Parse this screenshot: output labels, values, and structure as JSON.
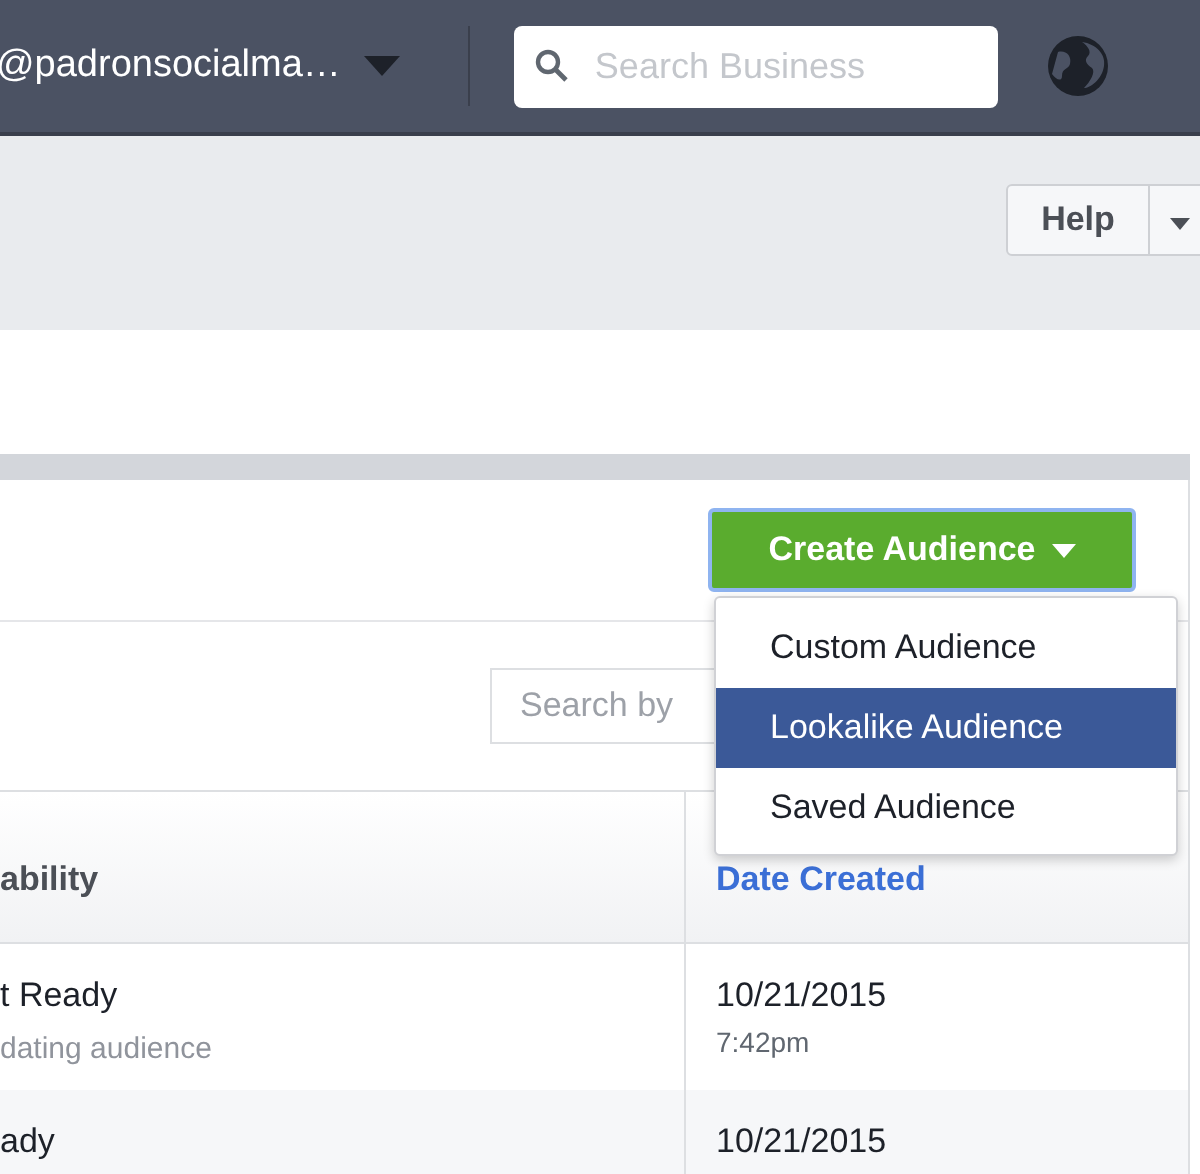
{
  "topbar": {
    "account": "@padronsocialma…",
    "search": {
      "placeholder": "Search Business"
    }
  },
  "help_button": {
    "label": "Help"
  },
  "create_button": {
    "label": "Create Audience"
  },
  "audience_search": {
    "placeholder": "Search by"
  },
  "dropdown": [
    {
      "label": "Custom Audience",
      "selected": false
    },
    {
      "label": "Lookalike Audience",
      "selected": true
    },
    {
      "label": "Saved Audience",
      "selected": false
    }
  ],
  "table": {
    "columns": [
      "ability",
      "Date Created"
    ],
    "rows": [
      {
        "status": "t Ready",
        "note": "dating audience",
        "date": "10/21/2015",
        "time": "7:42pm"
      },
      {
        "status": "ady",
        "date": "10/21/2015"
      }
    ]
  }
}
